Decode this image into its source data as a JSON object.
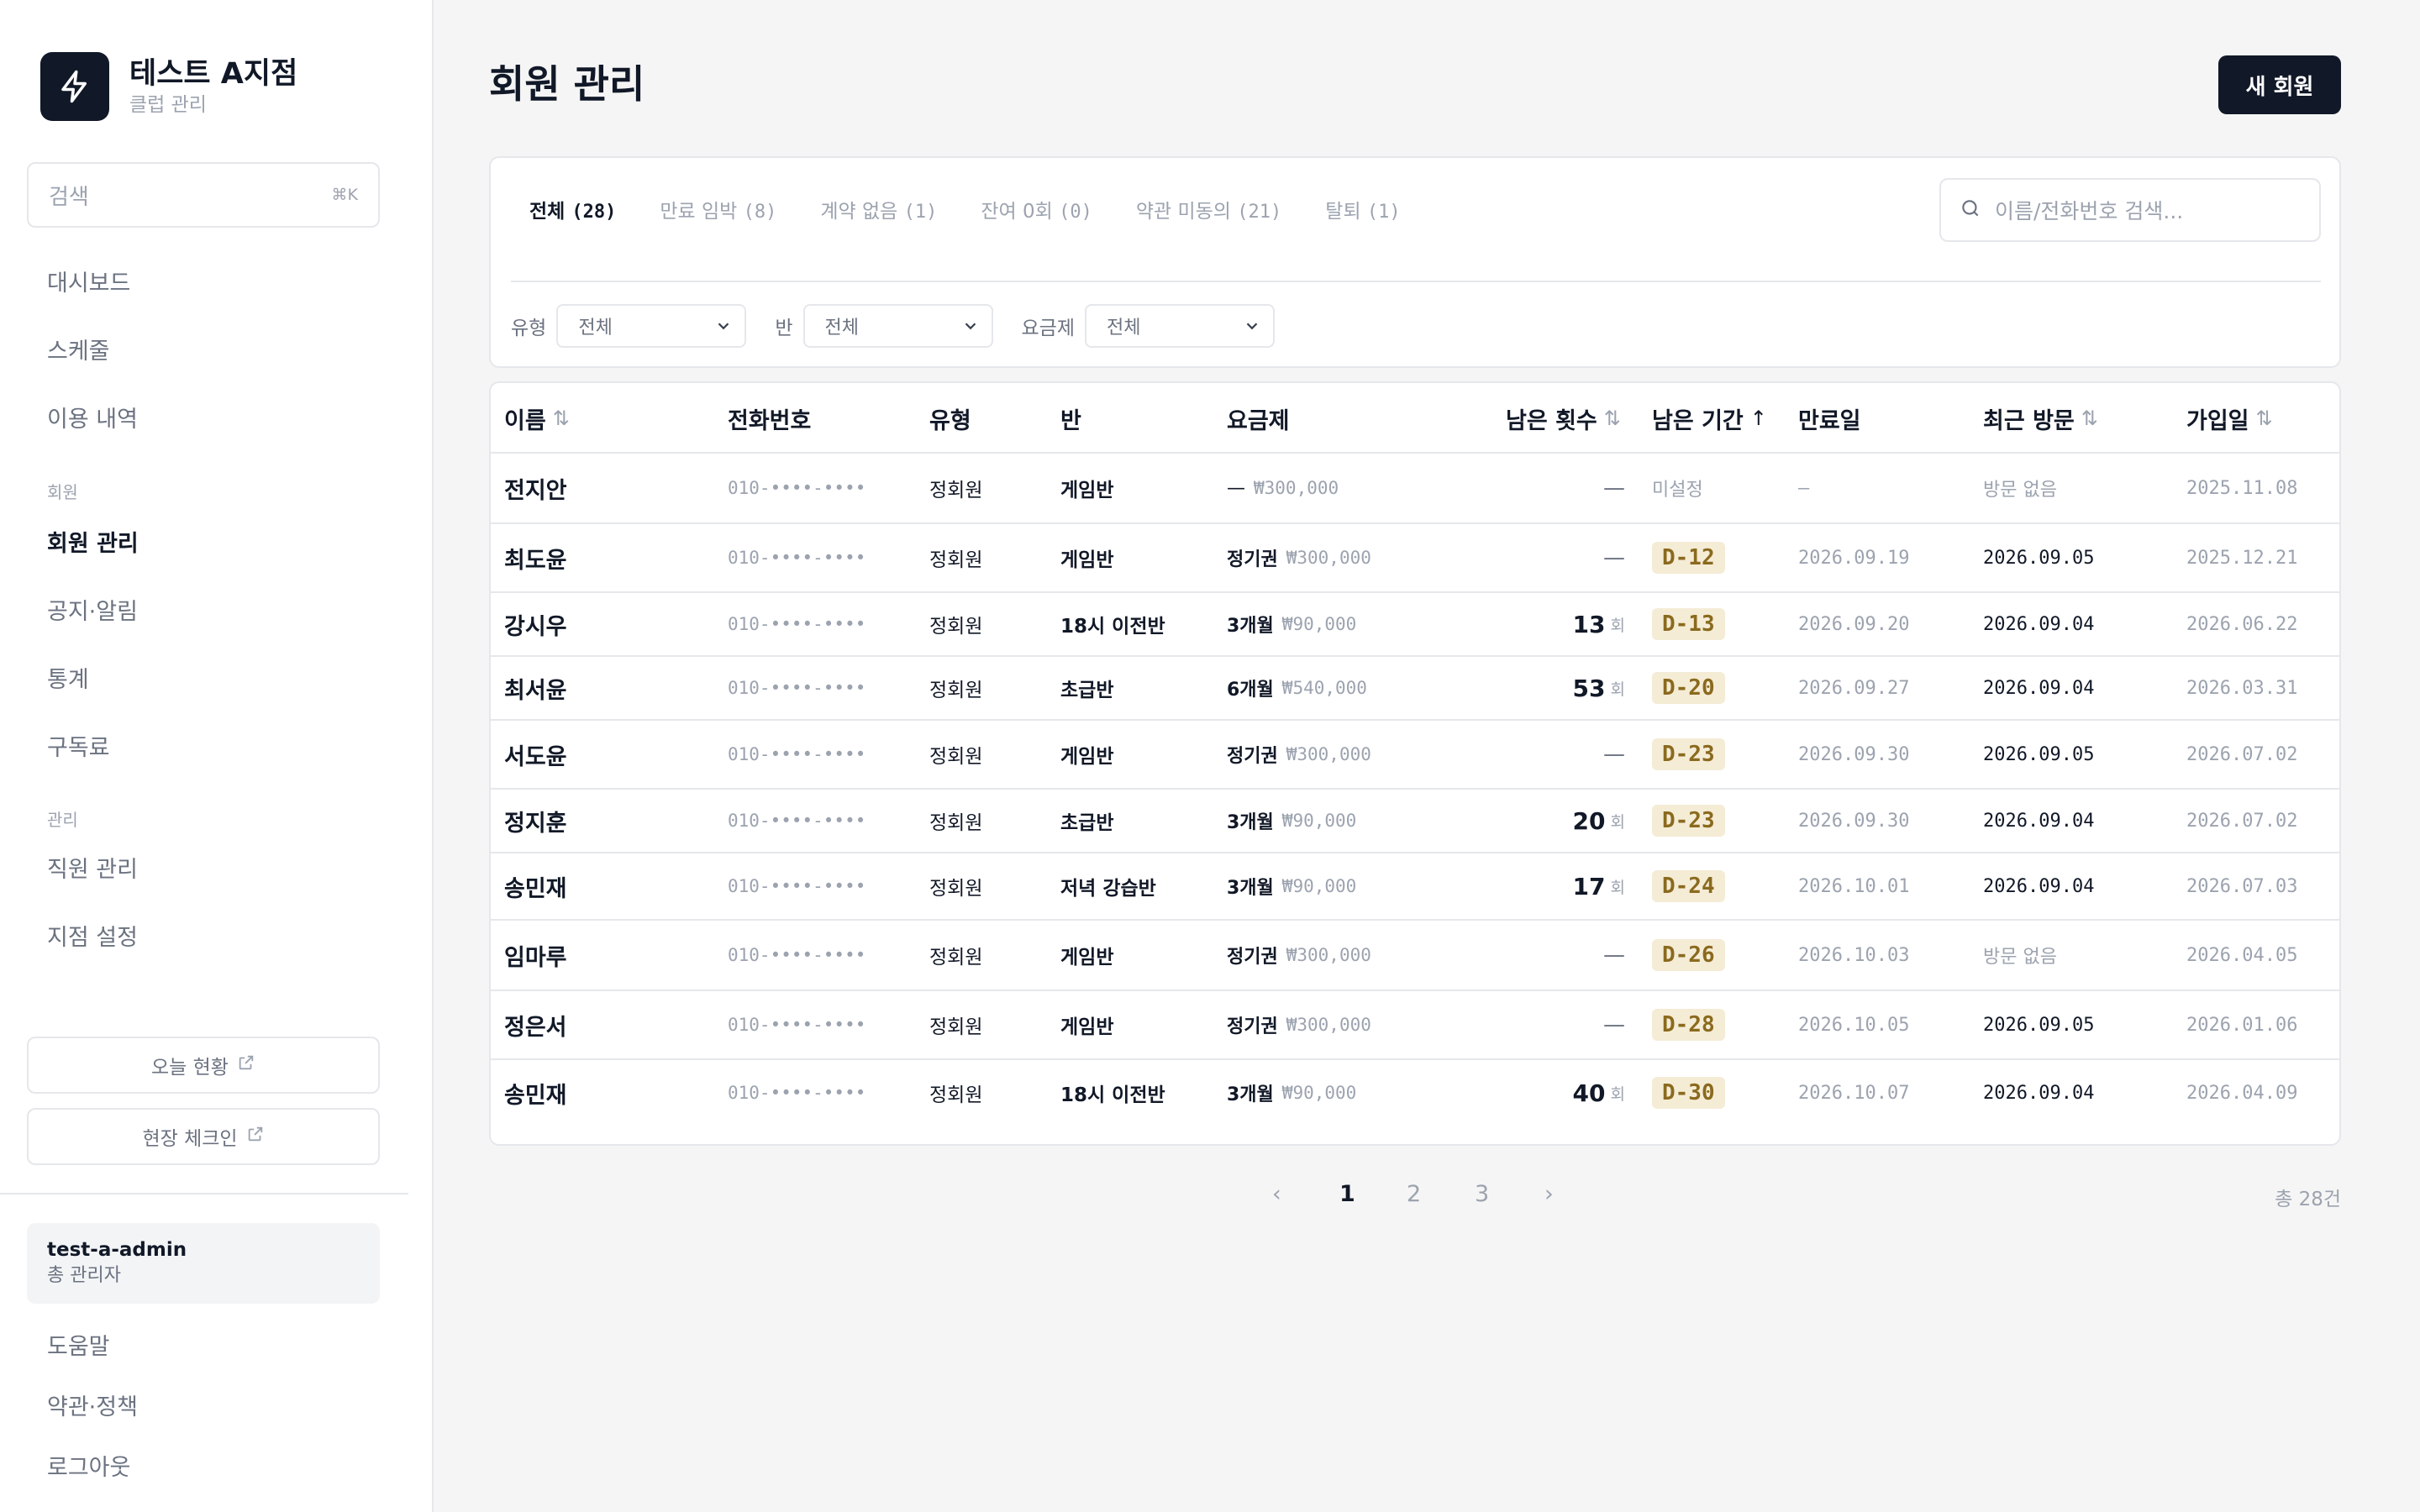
{
  "brand": {
    "title": "테스트 A지점",
    "subtitle": "클럽 관리"
  },
  "sidebar": {
    "search": {
      "placeholder": "검색",
      "shortcut": "⌘K"
    },
    "nav": [
      "대시보드",
      "스케줄",
      "이용 내역"
    ],
    "section_member": "회원",
    "member_nav": [
      "회원 관리",
      "공지·알림",
      "통계",
      "구독료"
    ],
    "section_admin": "관리",
    "admin_nav": [
      "직원 관리",
      "지점 설정"
    ],
    "today_btn": "오늘 현황",
    "checkin_btn": "현장 체크인",
    "user": {
      "name": "test-a-admin",
      "role": "총 관리자"
    },
    "footer_nav": [
      "도움말",
      "약관·정책",
      "로그아웃"
    ]
  },
  "page": {
    "title": "회원 관리",
    "new_button": "새 회원"
  },
  "tabs": [
    {
      "label": "전체",
      "count": "(28)"
    },
    {
      "label": "만료 임박",
      "count": "(8)"
    },
    {
      "label": "계약 없음",
      "count": "(1)"
    },
    {
      "label": "잔여 0회",
      "count": "(0)"
    },
    {
      "label": "약관 미동의",
      "count": "(21)"
    },
    {
      "label": "탈퇴",
      "count": "(1)"
    }
  ],
  "search": {
    "placeholder": "이름/전화번호 검색..."
  },
  "filters": [
    {
      "label": "유형",
      "value": "전체"
    },
    {
      "label": "반",
      "value": "전체"
    },
    {
      "label": "요금제",
      "value": "전체"
    }
  ],
  "table": {
    "columns": {
      "name": "이름",
      "phone": "전화번호",
      "type": "유형",
      "class": "반",
      "plan": "요금제",
      "remaining_count": "남은 횟수",
      "remaining_period": "남은 기간",
      "expiry": "만료일",
      "last_visit": "최근 방문",
      "joined": "가입일"
    },
    "count_unit": "회",
    "rows": [
      {
        "name": "전지안",
        "phone": "010-••••-••••",
        "type": "정회원",
        "class": "게임반",
        "plan": "—",
        "price": "₩300,000",
        "count": "—",
        "period": "미설정",
        "expiry": "–",
        "last_visit": "방문 없음",
        "joined": "2025.11.08"
      },
      {
        "name": "최도윤",
        "phone": "010-••••-••••",
        "type": "정회원",
        "class": "게임반",
        "plan": "정기권",
        "price": "₩300,000",
        "count": "—",
        "period": "D-12",
        "expiry": "2026.09.19",
        "last_visit": "2026.09.05",
        "joined": "2025.12.21"
      },
      {
        "name": "강시우",
        "phone": "010-••••-••••",
        "type": "정회원",
        "class": "18시 이전반",
        "plan": "3개월",
        "price": "₩90,000",
        "count": "13",
        "period": "D-13",
        "expiry": "2026.09.20",
        "last_visit": "2026.09.04",
        "joined": "2026.06.22"
      },
      {
        "name": "최서윤",
        "phone": "010-••••-••••",
        "type": "정회원",
        "class": "초급반",
        "plan": "6개월",
        "price": "₩540,000",
        "count": "53",
        "period": "D-20",
        "expiry": "2026.09.27",
        "last_visit": "2026.09.04",
        "joined": "2026.03.31"
      },
      {
        "name": "서도윤",
        "phone": "010-••••-••••",
        "type": "정회원",
        "class": "게임반",
        "plan": "정기권",
        "price": "₩300,000",
        "count": "—",
        "period": "D-23",
        "expiry": "2026.09.30",
        "last_visit": "2026.09.05",
        "joined": "2026.07.02"
      },
      {
        "name": "정지훈",
        "phone": "010-••••-••••",
        "type": "정회원",
        "class": "초급반",
        "plan": "3개월",
        "price": "₩90,000",
        "count": "20",
        "period": "D-23",
        "expiry": "2026.09.30",
        "last_visit": "2026.09.04",
        "joined": "2026.07.02"
      },
      {
        "name": "송민재",
        "phone": "010-••••-••••",
        "type": "정회원",
        "class": "저녁 강습반",
        "plan": "3개월",
        "price": "₩90,000",
        "count": "17",
        "period": "D-24",
        "expiry": "2026.10.01",
        "last_visit": "2026.09.04",
        "joined": "2026.07.03"
      },
      {
        "name": "임마루",
        "phone": "010-••••-••••",
        "type": "정회원",
        "class": "게임반",
        "plan": "정기권",
        "price": "₩300,000",
        "count": "—",
        "period": "D-26",
        "expiry": "2026.10.03",
        "last_visit": "방문 없음",
        "joined": "2026.04.05"
      },
      {
        "name": "정은서",
        "phone": "010-••••-••••",
        "type": "정회원",
        "class": "게임반",
        "plan": "정기권",
        "price": "₩300,000",
        "count": "—",
        "period": "D-28",
        "expiry": "2026.10.05",
        "last_visit": "2026.09.05",
        "joined": "2026.01.06"
      },
      {
        "name": "송민재",
        "phone": "010-••••-••••",
        "type": "정회원",
        "class": "18시 이전반",
        "plan": "3개월",
        "price": "₩90,000",
        "count": "40",
        "period": "D-30",
        "expiry": "2026.10.07",
        "last_visit": "2026.09.04",
        "joined": "2026.04.09"
      }
    ]
  },
  "pagination": {
    "prev": "‹",
    "pages": [
      "1",
      "2",
      "3"
    ],
    "next": "›",
    "current": "1",
    "total": "총 28건"
  },
  "colors": {
    "primary": "#111827",
    "badge_bg": "#f5ecd6",
    "badge_text": "#8a6a1e"
  },
  "icons": {
    "brand": "lightning-icon",
    "search": "search-icon",
    "external": "external-link-icon",
    "chevron": "chevron-down-icon",
    "sort": "sort-icon",
    "sort_up": "arrow-up-icon"
  }
}
